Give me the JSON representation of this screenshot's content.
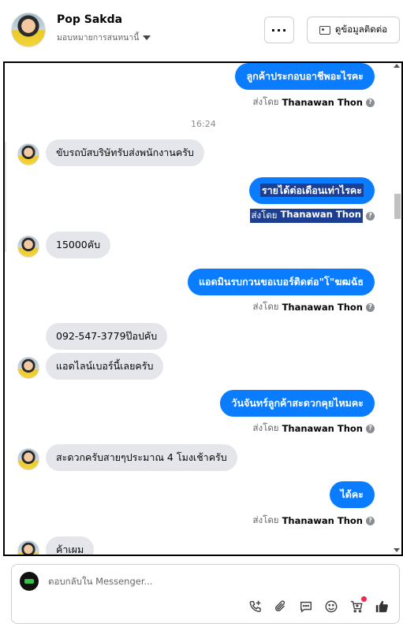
{
  "header": {
    "user_name": "Pop Sakda",
    "assign_label": "มอบหมายการสนทนานี้",
    "more_label": "···",
    "contact_label": "ดูข้อมูลติดต่อ"
  },
  "conversation": {
    "messages": [
      {
        "type": "out",
        "text": "ลูกค้าประกอบอาชีพอะไรคะ",
        "sent_by_prefix": "ส่งโดย",
        "sent_by": "Thanawan Thon"
      },
      {
        "type": "time",
        "text": "16:24"
      },
      {
        "type": "in",
        "text": "ขับรถบัสบริษัทรับส่งพนักงานครับ"
      },
      {
        "type": "out",
        "text": "รายได้ต่อเดือนเท่าไรคะ",
        "sent_by_prefix": "ส่งโดย",
        "sent_by": "Thanawan Thon",
        "selected": true
      },
      {
        "type": "in",
        "text": "15000คับ"
      },
      {
        "type": "out",
        "text": "แอดมินรบกวนขอเบอร์ติดต่อ\"โ\"ฆฒฉัธ",
        "sent_by_prefix": "ส่งโดย",
        "sent_by": "Thanawan Thon"
      },
      {
        "type": "in",
        "text": "092-547-3779ป๊อปคับ"
      },
      {
        "type": "in",
        "text": "แอดไลน์เบอร์นี้เลยครับ"
      },
      {
        "type": "out",
        "text": "วันจันทร์ลูกค้าสะดวกคุยไหมคะ",
        "sent_by_prefix": "ส่งโดย",
        "sent_by": "Thanawan Thon"
      },
      {
        "type": "in",
        "text": "สะดวกครับสายๆประมาณ 4 โมงเช้าครับ"
      },
      {
        "type": "out",
        "text": "ได้คะ",
        "sent_by_prefix": "ส่งโดย",
        "sent_by": "Thanawan Thon"
      },
      {
        "type": "in",
        "text": "ค้าเผม"
      }
    ],
    "help_glyph": "?"
  },
  "composer": {
    "placeholder": "ตอบกลับใน Messenger...",
    "tools": [
      "phone-plus-icon",
      "attachment-icon",
      "saved-reply-icon",
      "emoji-icon",
      "cart-icon",
      "like-icon"
    ]
  },
  "colors": {
    "outgoing_bubble": "#0a7cff",
    "incoming_bubble": "#e4e6eb",
    "selection": "#1c3f94",
    "notification_dot": "#f02849"
  }
}
